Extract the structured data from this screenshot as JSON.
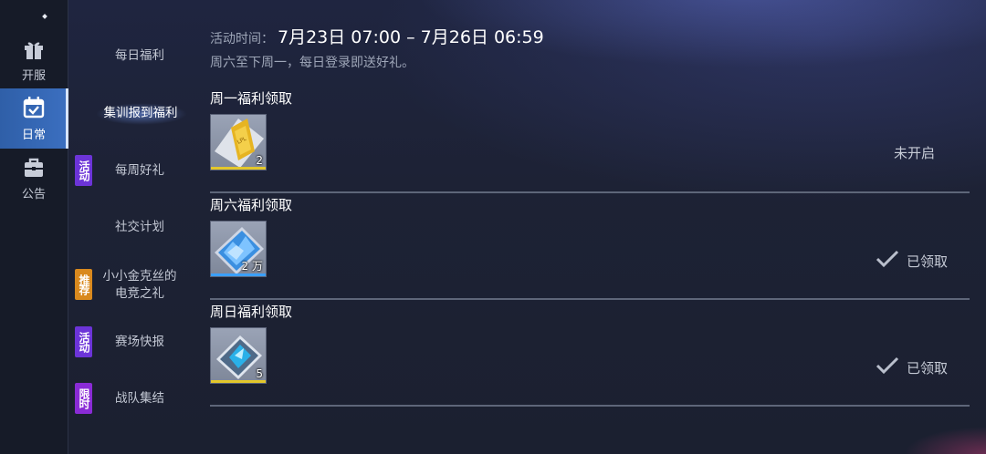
{
  "rail": {
    "items": [
      {
        "label": "开服",
        "icon": "gift-icon"
      },
      {
        "label": "日常",
        "icon": "calendar-check-icon",
        "active": true
      },
      {
        "label": "公告",
        "icon": "briefcase-icon"
      }
    ]
  },
  "menu": {
    "items": [
      {
        "label": "每日福利",
        "tag": ""
      },
      {
        "label": "集训报到福利",
        "tag": "",
        "selected": true
      },
      {
        "label": "每周好礼",
        "tag": "活动",
        "tag_color": "#6c34d8"
      },
      {
        "label": "社交计划",
        "tag": ""
      },
      {
        "label": "小小金克丝的\n电竞之礼",
        "tag": "推荐",
        "tag_color": "#d9891e"
      },
      {
        "label": "赛场快报",
        "tag": "活动",
        "tag_color": "#6c34d8"
      },
      {
        "label": "战队集结",
        "tag": "限时",
        "tag_color": "#8a2bd6"
      }
    ]
  },
  "event": {
    "time_label": "活动时间：",
    "time_value": "7月23日 07:00 – 7月26日 06:59",
    "description": "周六至下周一，每日登录即送好礼。"
  },
  "sections": [
    {
      "title": "周一福利领取",
      "reward_qty": "2",
      "reward_icon": "gold-ticket-icon",
      "bar_color": "#e3c72b",
      "status": "未开启"
    },
    {
      "title": "周六福利领取",
      "reward_qty": "2 万",
      "reward_icon": "blue-crystal-icon",
      "bar_color": "#3aa0ff",
      "status": "已领取"
    },
    {
      "title": "周日福利领取",
      "reward_qty": "5",
      "reward_icon": "emblem-card-icon",
      "bar_color": "#e3c72b",
      "status": "已领取"
    }
  ]
}
